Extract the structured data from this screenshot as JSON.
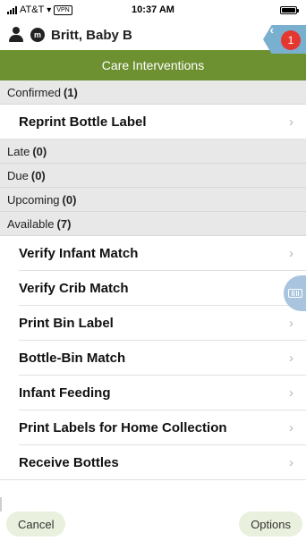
{
  "status_bar": {
    "carrier": "AT&T",
    "vpn": "VPN",
    "time": "10:37 AM"
  },
  "patient": {
    "initial": "m",
    "name": "Britt, Baby B"
  },
  "notification": {
    "count": "1"
  },
  "header": {
    "title": "Care Interventions"
  },
  "sections": {
    "confirmed": {
      "label": "Confirmed",
      "count": "(1)",
      "items": [
        "Reprint Bottle Label"
      ]
    },
    "late": {
      "label": "Late",
      "count": "(0)"
    },
    "due": {
      "label": "Due",
      "count": "(0)"
    },
    "upcoming": {
      "label": "Upcoming",
      "count": "(0)"
    },
    "available": {
      "label": "Available",
      "count": "(7)",
      "items": [
        "Verify Infant Match",
        "Verify Crib Match",
        "Print Bin Label",
        "Bottle-Bin Match",
        "Infant Feeding",
        "Print Labels for Home Collection",
        "Receive Bottles"
      ]
    }
  },
  "footer": {
    "cancel_label": "Cancel",
    "options_label": "Options"
  },
  "colors": {
    "header_green": "#6d9130",
    "badge_red": "#e5362f",
    "pill_bg": "#e9f0dd",
    "section_gray": "#e8e8e8"
  }
}
